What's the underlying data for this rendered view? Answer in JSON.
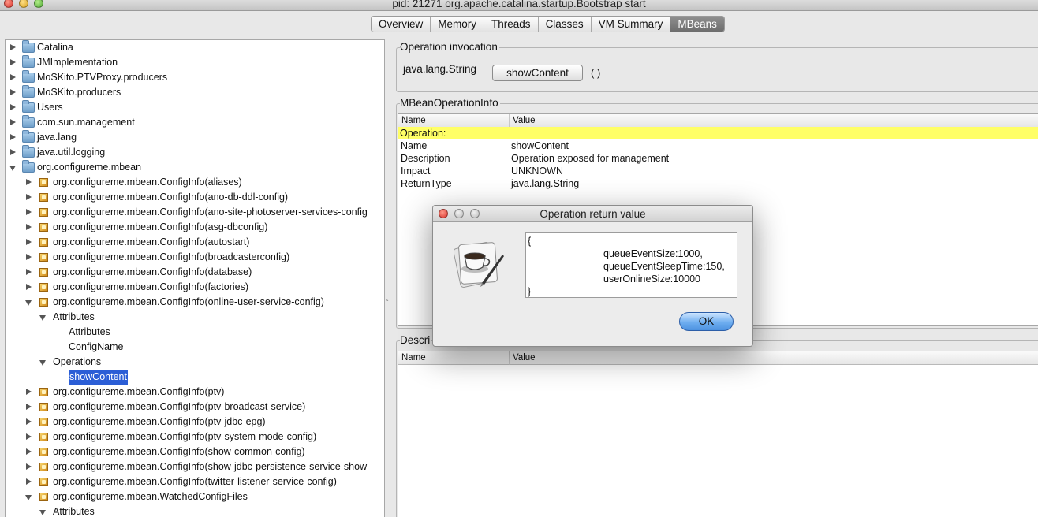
{
  "window": {
    "title": "pid: 21271 org.apache.catalina.startup.Bootstrap start"
  },
  "tabs": [
    {
      "label": "Overview",
      "active": false
    },
    {
      "label": "Memory",
      "active": false
    },
    {
      "label": "Threads",
      "active": false
    },
    {
      "label": "Classes",
      "active": false
    },
    {
      "label": "VM Summary",
      "active": false
    },
    {
      "label": "MBeans",
      "active": true
    }
  ],
  "tree": [
    {
      "label": "Catalina",
      "level": 0,
      "kind": "folder",
      "state": "collapsed"
    },
    {
      "label": "JMImplementation",
      "level": 0,
      "kind": "folder",
      "state": "collapsed"
    },
    {
      "label": "MoSKito.PTVProxy.producers",
      "level": 0,
      "kind": "folder",
      "state": "collapsed"
    },
    {
      "label": "MoSKito.producers",
      "level": 0,
      "kind": "folder",
      "state": "collapsed"
    },
    {
      "label": "Users",
      "level": 0,
      "kind": "folder",
      "state": "collapsed"
    },
    {
      "label": "com.sun.management",
      "level": 0,
      "kind": "folder",
      "state": "collapsed"
    },
    {
      "label": "java.lang",
      "level": 0,
      "kind": "folder",
      "state": "collapsed"
    },
    {
      "label": "java.util.logging",
      "level": 0,
      "kind": "folder",
      "state": "collapsed"
    },
    {
      "label": "org.configureme.mbean",
      "level": 0,
      "kind": "folder",
      "state": "expanded"
    },
    {
      "label": "org.configureme.mbean.ConfigInfo(aliases)",
      "level": 1,
      "kind": "bean",
      "state": "collapsed"
    },
    {
      "label": "org.configureme.mbean.ConfigInfo(ano-db-ddl-config)",
      "level": 1,
      "kind": "bean",
      "state": "collapsed"
    },
    {
      "label": "org.configureme.mbean.ConfigInfo(ano-site-photoserver-services-config",
      "level": 1,
      "kind": "bean",
      "state": "collapsed"
    },
    {
      "label": "org.configureme.mbean.ConfigInfo(asg-dbconfig)",
      "level": 1,
      "kind": "bean",
      "state": "collapsed"
    },
    {
      "label": "org.configureme.mbean.ConfigInfo(autostart)",
      "level": 1,
      "kind": "bean",
      "state": "collapsed"
    },
    {
      "label": "org.configureme.mbean.ConfigInfo(broadcasterconfig)",
      "level": 1,
      "kind": "bean",
      "state": "collapsed"
    },
    {
      "label": "org.configureme.mbean.ConfigInfo(database)",
      "level": 1,
      "kind": "bean",
      "state": "collapsed"
    },
    {
      "label": "org.configureme.mbean.ConfigInfo(factories)",
      "level": 1,
      "kind": "bean",
      "state": "collapsed"
    },
    {
      "label": "org.configureme.mbean.ConfigInfo(online-user-service-config)",
      "level": 1,
      "kind": "bean",
      "state": "expanded"
    },
    {
      "label": "Attributes",
      "level": 2,
      "kind": "none",
      "state": "expanded"
    },
    {
      "label": "Attributes",
      "level": 3,
      "kind": "none",
      "state": "leaf"
    },
    {
      "label": "ConfigName",
      "level": 3,
      "kind": "none",
      "state": "leaf"
    },
    {
      "label": "Operations",
      "level": 2,
      "kind": "none",
      "state": "expanded"
    },
    {
      "label": "showContent",
      "level": 3,
      "kind": "none",
      "state": "leaf",
      "selected": true
    },
    {
      "label": "org.configureme.mbean.ConfigInfo(ptv)",
      "level": 1,
      "kind": "bean",
      "state": "collapsed"
    },
    {
      "label": "org.configureme.mbean.ConfigInfo(ptv-broadcast-service)",
      "level": 1,
      "kind": "bean",
      "state": "collapsed"
    },
    {
      "label": "org.configureme.mbean.ConfigInfo(ptv-jdbc-epg)",
      "level": 1,
      "kind": "bean",
      "state": "collapsed"
    },
    {
      "label": "org.configureme.mbean.ConfigInfo(ptv-system-mode-config)",
      "level": 1,
      "kind": "bean",
      "state": "collapsed"
    },
    {
      "label": "org.configureme.mbean.ConfigInfo(show-common-config)",
      "level": 1,
      "kind": "bean",
      "state": "collapsed"
    },
    {
      "label": "org.configureme.mbean.ConfigInfo(show-jdbc-persistence-service-show",
      "level": 1,
      "kind": "bean",
      "state": "collapsed"
    },
    {
      "label": "org.configureme.mbean.ConfigInfo(twitter-listener-service-config)",
      "level": 1,
      "kind": "bean",
      "state": "collapsed"
    },
    {
      "label": "org.configureme.mbean.WatchedConfigFiles",
      "level": 1,
      "kind": "bean",
      "state": "expanded"
    },
    {
      "label": "Attributes",
      "level": 2,
      "kind": "none",
      "state": "expanded"
    }
  ],
  "invocation": {
    "title": "Operation invocation",
    "return_type": "java.lang.String",
    "button_label": "showContent",
    "params": "( )"
  },
  "info": {
    "title": "MBeanOperationInfo",
    "headers": {
      "name": "Name",
      "value": "Value"
    },
    "highlight": "Operation:",
    "rows": [
      {
        "name": "Name",
        "value": "showContent"
      },
      {
        "name": "Description",
        "value": "Operation exposed for management"
      },
      {
        "name": "Impact",
        "value": "UNKNOWN"
      },
      {
        "name": "ReturnType",
        "value": "java.lang.String"
      }
    ]
  },
  "descriptor": {
    "title": "Descri",
    "headers": {
      "name": "Name",
      "value": "Value"
    }
  },
  "dialog": {
    "title": "Operation return value",
    "lines": [
      "{",
      "queueEventSize:1000,",
      "queueEventSleepTime:150,",
      "userOnlineSize:10000",
      "}"
    ],
    "ok_label": "OK"
  },
  "colors": {
    "selection": "#2b5ed6",
    "highlight_row": "#ffff66",
    "active_tab": "#7a7a7a"
  }
}
